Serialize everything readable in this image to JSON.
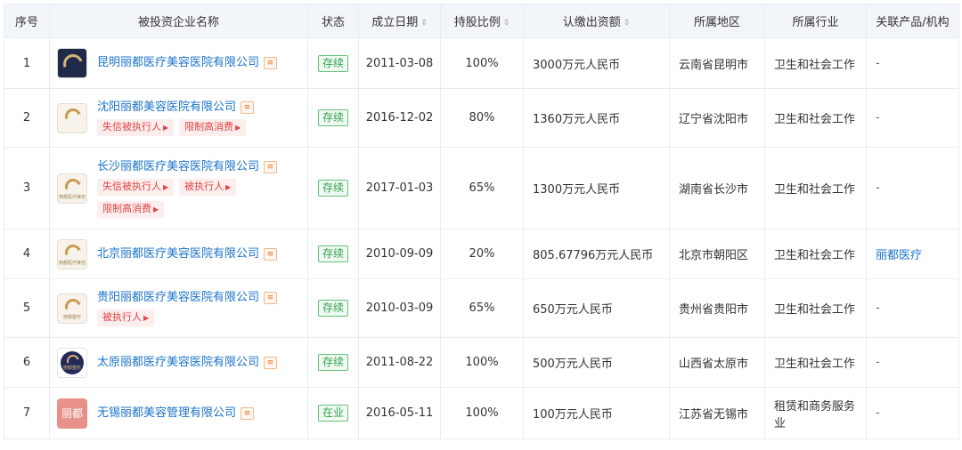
{
  "columns": {
    "seq": "序号",
    "company": "被投资企业名称",
    "status": "状态",
    "founded": "成立日期",
    "ratio": "持股比例",
    "capital": "认缴出资额",
    "region": "所属地区",
    "industry": "所属行业",
    "related": "关联产品/机构"
  },
  "sort_glyph": "⇕",
  "rows": [
    {
      "seq": "1",
      "logo": "swan-logo-dark",
      "logo_caption": "",
      "name": "昆明丽都医疗美容医院有限公司",
      "tags": [],
      "status": "存续",
      "founded": "2011-03-08",
      "ratio": "100%",
      "capital": "3000万元人民币",
      "region": "云南省昆明市",
      "industry": "卫生和社会工作",
      "related": "-"
    },
    {
      "seq": "2",
      "logo": "swan-logo-light",
      "logo_caption": "",
      "name": "沈阳丽都美容医院有限公司",
      "tags": [
        "失信被执行人",
        "限制高消费"
      ],
      "status": "存续",
      "founded": "2016-12-02",
      "ratio": "80%",
      "capital": "1360万元人民币",
      "region": "辽宁省沈阳市",
      "industry": "卫生和社会工作",
      "related": "-"
    },
    {
      "seq": "3",
      "logo": "swan-logo-light",
      "logo_caption": "丽都医疗美容",
      "name": "长沙丽都医疗美容医院有限公司",
      "tags": [
        "失信被执行人",
        "被执行人",
        "限制高消费"
      ],
      "status": "存续",
      "founded": "2017-01-03",
      "ratio": "65%",
      "capital": "1300万元人民币",
      "region": "湖南省长沙市",
      "industry": "卫生和社会工作",
      "related": "-"
    },
    {
      "seq": "4",
      "logo": "swan-logo-light",
      "logo_caption": "丽都医疗美容",
      "name": "北京丽都医疗美容医院有限公司",
      "tags": [],
      "status": "存续",
      "founded": "2010-09-09",
      "ratio": "20%",
      "capital": "805.67796万元人民币",
      "region": "北京市朝阳区",
      "industry": "卫生和社会工作",
      "related": "丽都医疗"
    },
    {
      "seq": "5",
      "logo": "swan-logo-light",
      "logo_caption": "丽都整形",
      "name": "贵阳丽都医疗美容医院有限公司",
      "tags": [
        "被执行人"
      ],
      "status": "存续",
      "founded": "2010-03-09",
      "ratio": "65%",
      "capital": "650万元人民币",
      "region": "贵州省贵阳市",
      "industry": "卫生和社会工作",
      "related": "-"
    },
    {
      "seq": "6",
      "logo": "swan-logo-circle",
      "logo_caption": "丽都整形",
      "name": "太原丽都医疗美容医院有限公司",
      "tags": [],
      "status": "存续",
      "founded": "2011-08-22",
      "ratio": "100%",
      "capital": "500万元人民币",
      "region": "山西省太原市",
      "industry": "卫生和社会工作",
      "related": "-"
    },
    {
      "seq": "7",
      "logo": "text-logo-pink",
      "logo_caption": "丽都",
      "name": "无锡丽都美容管理有限公司",
      "tags": [],
      "status": "在业",
      "founded": "2016-05-11",
      "ratio": "100%",
      "capital": "100万元人民币",
      "region": "江苏省无锡市",
      "industry": "租赁和商务服务业",
      "related": "-"
    }
  ],
  "colors": {
    "header_bg": "#f2f6fb",
    "link": "#1a73c9",
    "status_green": "#2ea44f",
    "tag_red": "#e24444",
    "tree_icon_orange": "#e86f1f"
  }
}
